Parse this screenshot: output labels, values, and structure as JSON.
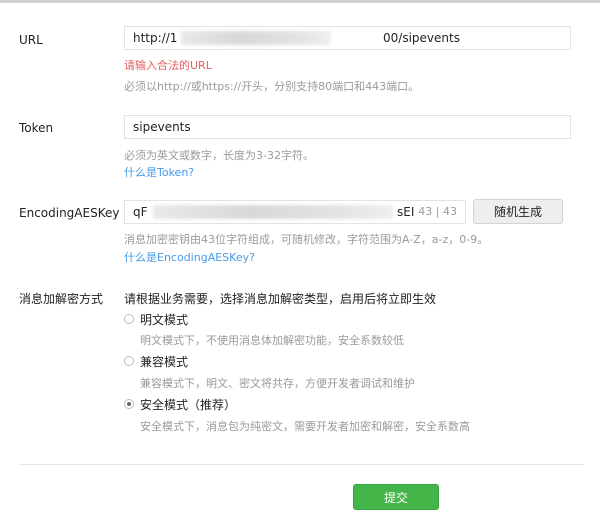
{
  "url": {
    "label": "URL",
    "value_prefix": "http://1",
    "value_suffix": "00/sipevents",
    "error": "请输入合法的URL",
    "hint": "必须以http://或https://开头，分别支持80端口和443端口。"
  },
  "token": {
    "label": "Token",
    "value": "sipevents",
    "hint": "必须为英文或数字，长度为3-32字符。",
    "help_link": "什么是Token?"
  },
  "aes_key": {
    "label": "EncodingAESKey",
    "value_prefix": "qF",
    "value_suffix": "sEI",
    "counter": "43 | 43",
    "generate_button": "随机生成",
    "hint": "消息加密密钥由43位字符组成，可随机修改，字符范围为A-Z，a-z，0-9。",
    "help_link": "什么是EncodingAESKey?"
  },
  "encryption": {
    "label": "消息加解密方式",
    "intro": "请根据业务需要，选择消息加解密类型，启用后将立即生效",
    "options": [
      {
        "label": "明文模式",
        "desc": "明文模式下，不使用消息体加解密功能，安全系数较低",
        "checked": false
      },
      {
        "label": "兼容模式",
        "desc": "兼容模式下，明文、密文将共存，方便开发者调试和维护",
        "checked": false
      },
      {
        "label": "安全模式（推荐）",
        "desc": "安全模式下，消息包为纯密文，需要开发者加密和解密，安全系数高",
        "checked": true
      }
    ]
  },
  "submit_label": "提交"
}
